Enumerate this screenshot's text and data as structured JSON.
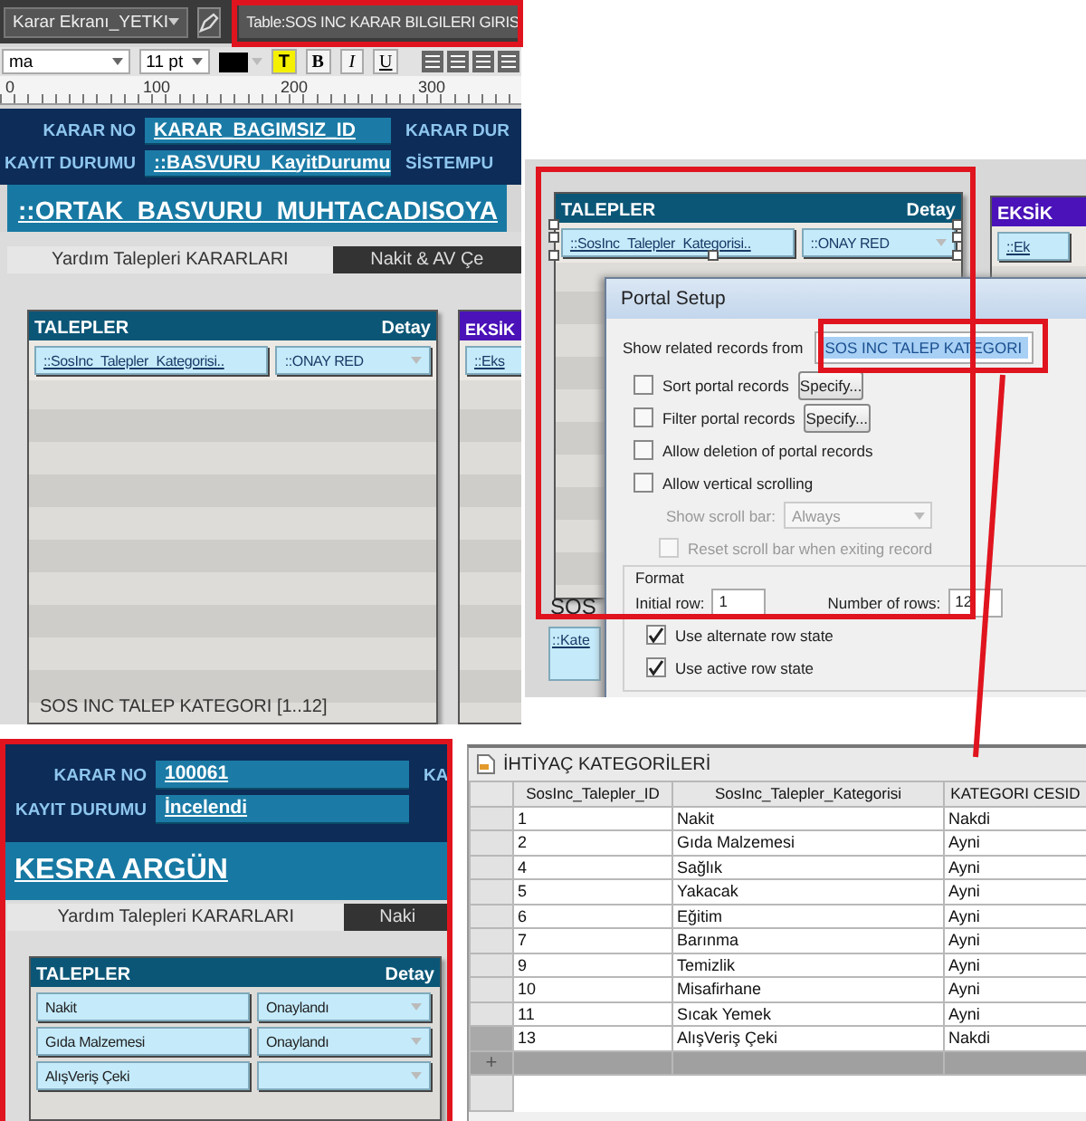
{
  "layout_view": {
    "layout_select": "Karar Ekranı_YETKI",
    "table_label": "Table:SOS INC KARAR BILGILERI GIRIS",
    "font_select": "ma",
    "font_size": "11 pt",
    "format_buttons": [
      {
        "label": "T",
        "kind": "highlight"
      },
      {
        "label": "B",
        "kind": "bold"
      },
      {
        "label": "I",
        "kind": "italic"
      },
      {
        "label": "U",
        "kind": "underline"
      }
    ],
    "ruler_labels": [
      "0",
      "100",
      "200",
      "300"
    ],
    "header_fields": [
      {
        "label": "KARAR NO",
        "value": "KARAR_BAGIMSIZ_ID"
      },
      {
        "label": "KAYIT DURUMU",
        "value": "::BASVURU_KayitDurumu"
      }
    ],
    "header_right_labels": [
      "KARAR DUR",
      "SİSTEMPU"
    ],
    "title": "::ORTAK_BASVURU_MUHTACADISOYA",
    "tabs": [
      {
        "label": "Yardım Talepleri KARARLARI",
        "selected": true
      },
      {
        "label": "Nakit & AV Çe",
        "selected": false
      }
    ],
    "portal": {
      "title": "TALEPLER",
      "detail": "Detay",
      "fields": [
        "::SosInc_Talepler_Kategorisi..",
        "::ONAY RED"
      ],
      "footer": "SOS INC TALEP KATEGORI [1..12]"
    },
    "side_portal": {
      "title": "EKSİK",
      "field": "::Eks"
    }
  },
  "portal_setup": {
    "portal": {
      "title": "TALEPLER",
      "detail": "Detay",
      "fields": [
        "::SosInc_Talepler_Kategorisi..",
        "::ONAY RED"
      ],
      "footer": "SOS"
    },
    "side_portal": {
      "title": "EKSİK",
      "field": "::Ek"
    },
    "behind_field": "::Kate",
    "dialog": {
      "title": "Portal Setup",
      "source_label": "Show related records from",
      "source_value": "SOS INC TALEP KATEGORI",
      "options": [
        {
          "kind": "checkbox",
          "label": "Sort portal records",
          "checked": false,
          "disabled": false,
          "button": "Specify..."
        },
        {
          "kind": "checkbox",
          "label": "Filter portal records",
          "checked": false,
          "disabled": false,
          "button": "Specify..."
        },
        {
          "kind": "checkbox",
          "label": "Allow deletion of portal records",
          "checked": false,
          "disabled": false
        },
        {
          "kind": "checkbox",
          "label": "Allow vertical scrolling",
          "checked": false,
          "disabled": false
        },
        {
          "kind": "select",
          "label": "Show scroll bar:",
          "value": "Always",
          "disabled": true
        },
        {
          "kind": "checkbox",
          "label": "Reset scroll bar when exiting record",
          "checked": false,
          "disabled": true
        }
      ],
      "format_title": "Format",
      "initial_row_label": "Initial row:",
      "initial_row": "1",
      "rows_label": "Number of rows:",
      "rows": "12",
      "row_options": [
        {
          "label": "Use alternate row state",
          "checked": true
        },
        {
          "label": "Use active row state",
          "checked": true
        }
      ]
    }
  },
  "browse_view": {
    "header_fields": [
      {
        "label": "KARAR NO",
        "value": "100061"
      },
      {
        "label": "KAYIT DURUMU",
        "value": "İncelendi"
      }
    ],
    "header_right_labels": [
      "KA"
    ],
    "title": "KESRA ARGÜN",
    "tabs": [
      {
        "label": "Yardım Talepleri KARARLARI",
        "selected": true
      },
      {
        "label": "Naki",
        "selected": false
      }
    ],
    "portal": {
      "title": "TALEPLER",
      "detail": "Detay",
      "rows": [
        {
          "category": "Nakit",
          "status": "Onaylandı"
        },
        {
          "category": "Gıda Malzemesi",
          "status": "Onaylandı"
        },
        {
          "category": "AlışVeriş Çeki",
          "status": ""
        }
      ]
    }
  },
  "table_view": {
    "title": "İHTİYAÇ KATEGORİLERİ",
    "columns": [
      "SosInc_Talepler_ID",
      "SosInc_Talepler_Kategorisi",
      "KATEGORI CESID"
    ],
    "rows": [
      {
        "cells": [
          "1",
          "Nakit",
          "Nakdi"
        ],
        "selected": false
      },
      {
        "cells": [
          "2",
          "Gıda Malzemesi",
          "Ayni"
        ],
        "selected": false
      },
      {
        "cells": [
          "4",
          "Sağlık",
          "Ayni"
        ],
        "selected": false
      },
      {
        "cells": [
          "5",
          "Yakacak",
          "Ayni"
        ],
        "selected": false
      },
      {
        "cells": [
          "6",
          "Eğitim",
          "Ayni"
        ],
        "selected": false
      },
      {
        "cells": [
          "7",
          "Barınma",
          "Ayni"
        ],
        "selected": false
      },
      {
        "cells": [
          "9",
          "Temizlik",
          "Ayni"
        ],
        "selected": false
      },
      {
        "cells": [
          "10",
          "Misafirhane",
          "Ayni"
        ],
        "selected": false
      },
      {
        "cells": [
          "11",
          "Sıcak Yemek",
          "Ayni"
        ],
        "selected": false
      },
      {
        "cells": [
          "13",
          "AlışVeriş Çeki",
          "Nakdi"
        ],
        "selected": true
      }
    ],
    "new_row": "+"
  }
}
